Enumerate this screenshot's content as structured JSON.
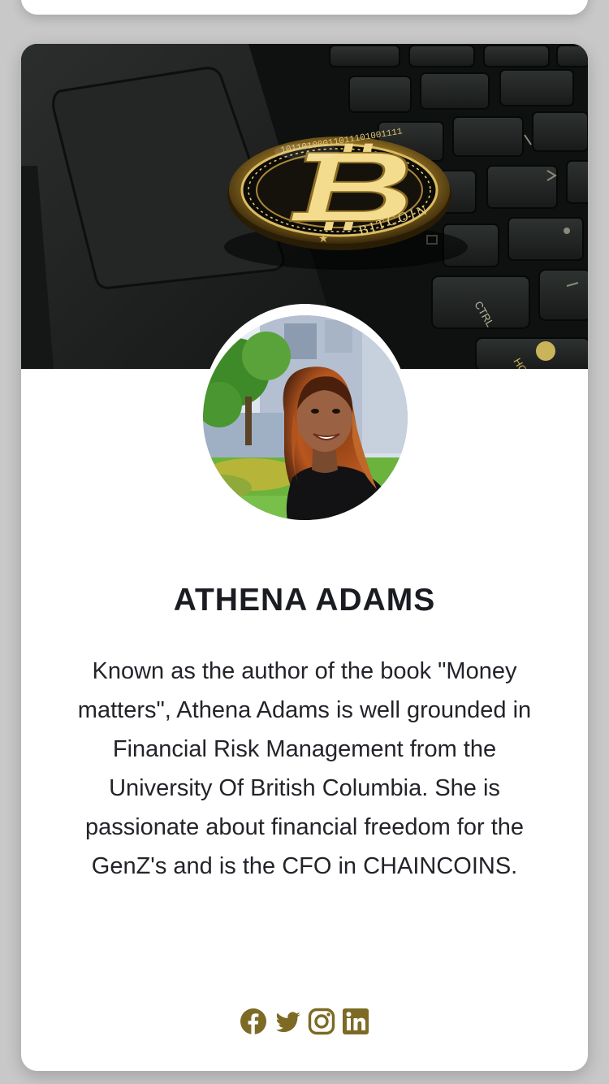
{
  "profile": {
    "name": "ATHENA ADAMS",
    "bio": "Known as the author of the book \"Money matters\", Athena Adams is well grounded in Financial Risk Management from the University Of British Columbia. She is passionate about financial freedom for the GenZ's and is the CFO in CHAINCOINS."
  },
  "cover": {
    "coin_text": "BITCOIN",
    "keys": [
      "CTRL",
      "HOME"
    ]
  },
  "socials": [
    {
      "icon": "facebook-icon"
    },
    {
      "icon": "twitter-icon"
    },
    {
      "icon": "instagram-icon"
    },
    {
      "icon": "linkedin-icon"
    }
  ],
  "colors": {
    "accent": "#7d6a25",
    "name_text": "#1a1c22",
    "body_text": "#23242a",
    "page_background": "#c8c8c8",
    "card_background": "#ffffff"
  }
}
